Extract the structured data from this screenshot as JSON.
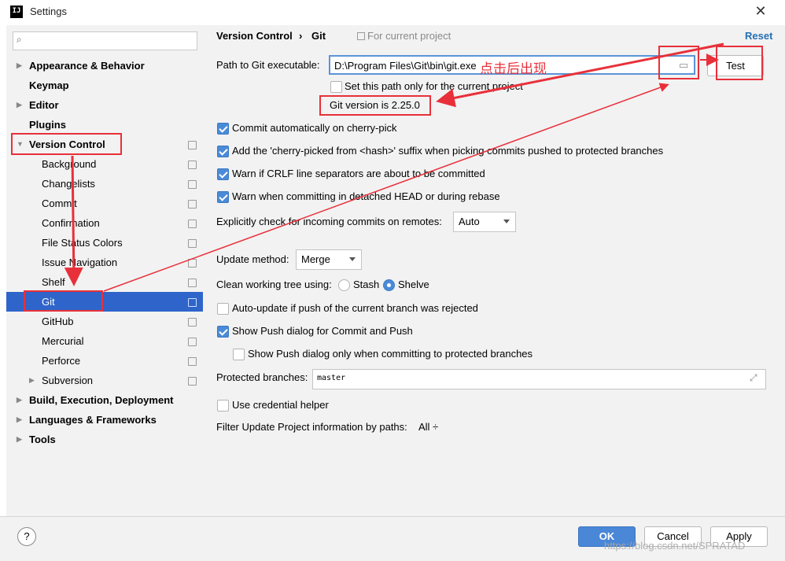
{
  "window": {
    "title": "Settings",
    "app_icon": "IJ"
  },
  "colors": {
    "selection": "#2f65ca",
    "accent_link": "#2470b3",
    "annotation_red": "#e8303a",
    "checkbox_blue": "#4a8bd8"
  },
  "sidebar": {
    "search_placeholder": "",
    "items": [
      {
        "label": "Appearance & Behavior"
      },
      {
        "label": "Keymap"
      },
      {
        "label": "Editor"
      },
      {
        "label": "Plugins"
      },
      {
        "label": "Version Control"
      },
      {
        "label": "Background"
      },
      {
        "label": "Changelists"
      },
      {
        "label": "Commit"
      },
      {
        "label": "Confirmation"
      },
      {
        "label": "File Status Colors"
      },
      {
        "label": "Issue Navigation"
      },
      {
        "label": "Shelf"
      },
      {
        "label": "Git"
      },
      {
        "label": "GitHub"
      },
      {
        "label": "Mercurial"
      },
      {
        "label": "Perforce"
      },
      {
        "label": "Subversion"
      },
      {
        "label": "Build, Execution, Deployment"
      },
      {
        "label": "Languages & Frameworks"
      },
      {
        "label": "Tools"
      }
    ]
  },
  "header": {
    "crumb_parent": "Version Control",
    "crumb_sep": "›",
    "crumb_current": "Git",
    "scope_note": "For current project",
    "reset_label": "Reset"
  },
  "git": {
    "path_label": "Path to Git executable:",
    "path_value": "D:\\Program Files\\Git\\bin\\git.exe",
    "test_label": "Test",
    "path_only_label": "Set this path only for the current project",
    "version_text": "Git version is 2.25.0",
    "annotation_text": "点击后出现",
    "commit_cherry": "Commit automatically on cherry-pick",
    "add_suffix": "Add the 'cherry-picked from <hash>' suffix when picking commits pushed to protected branches",
    "warn_crlf": "Warn if CRLF line separators are about to be committed",
    "warn_detached": "Warn when committing in detached HEAD or during rebase",
    "incoming_label": "Explicitly check for incoming commits on remotes:",
    "incoming_value": "Auto",
    "update_method_label": "Update method:",
    "update_method_value": "Merge",
    "clean_tree_label": "Clean working tree using:",
    "stash_label": "Stash",
    "shelve_label": "Shelve",
    "auto_update": "Auto-update if push of the current branch was rejected",
    "show_push": "Show Push dialog for Commit and Push",
    "show_push_protected": "Show Push dialog only when committing to protected branches",
    "protected_label": "Protected branches:",
    "protected_value": "master",
    "credential": "Use credential helper",
    "filter_label": "Filter Update Project information by paths:",
    "filter_value": "All ÷"
  },
  "footer": {
    "help": "?",
    "ok": "OK",
    "cancel": "Cancel",
    "apply": "Apply",
    "watermark": "https://blog.csdn.net/SPRATAD"
  }
}
